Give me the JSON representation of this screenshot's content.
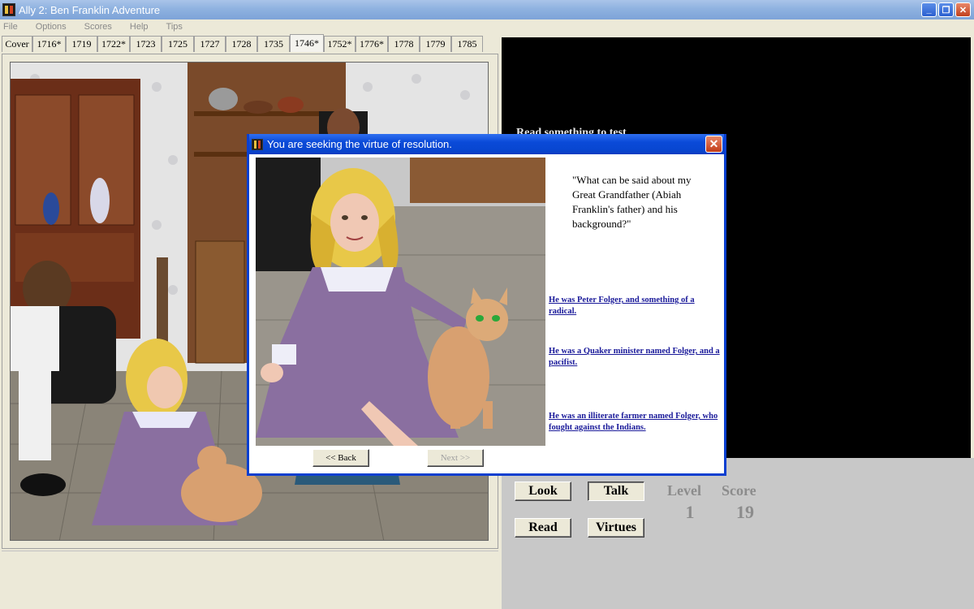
{
  "window": {
    "title": "Ally 2: Ben Franklin Adventure",
    "buttons": {
      "minimize": "_",
      "restore": "❐",
      "close": "✕"
    }
  },
  "menu": [
    "File",
    "Options",
    "Scores",
    "Help",
    "Tips"
  ],
  "tabs": [
    {
      "label": "Cover",
      "active": false
    },
    {
      "label": "1716*",
      "active": false
    },
    {
      "label": "1719",
      "active": false
    },
    {
      "label": "1722*",
      "active": false
    },
    {
      "label": "1723",
      "active": false
    },
    {
      "label": "1725",
      "active": false
    },
    {
      "label": "1727",
      "active": false
    },
    {
      "label": "1728",
      "active": false
    },
    {
      "label": "1735",
      "active": false
    },
    {
      "label": "1746*",
      "active": true
    },
    {
      "label": "1752*",
      "active": false
    },
    {
      "label": "1776*",
      "active": false
    },
    {
      "label": "1778",
      "active": false
    },
    {
      "label": "1779",
      "active": false
    },
    {
      "label": "1785",
      "active": false
    }
  ],
  "right_panel": {
    "black_text": "Read something to test",
    "buttons": {
      "look": "Look",
      "talk": "Talk",
      "read": "Read",
      "virtues": "Virtues"
    },
    "level_label": "Level",
    "score_label": "Score",
    "level_value": "1",
    "score_value": "19"
  },
  "dialog": {
    "title": "You are seeking the virtue of resolution.",
    "close": "✕",
    "question": "\"What can be said about my Great Grandfather (Abiah Franklin's father) and his background?\"",
    "answers": [
      "He was Peter Folger, and something of a radical.",
      "He was a Quaker minister named Folger, and a pacifist.",
      "He was an illiterate farmer named Folger, who fought against the Indians."
    ],
    "back": "<< Back",
    "next": "Next >>"
  },
  "colors": {
    "title_bar": "#8fb2e0",
    "dialog_title": "#0a4ad8",
    "link": "#1a1a9a",
    "dress": "#8a6fa0",
    "hair": "#e8c848"
  }
}
